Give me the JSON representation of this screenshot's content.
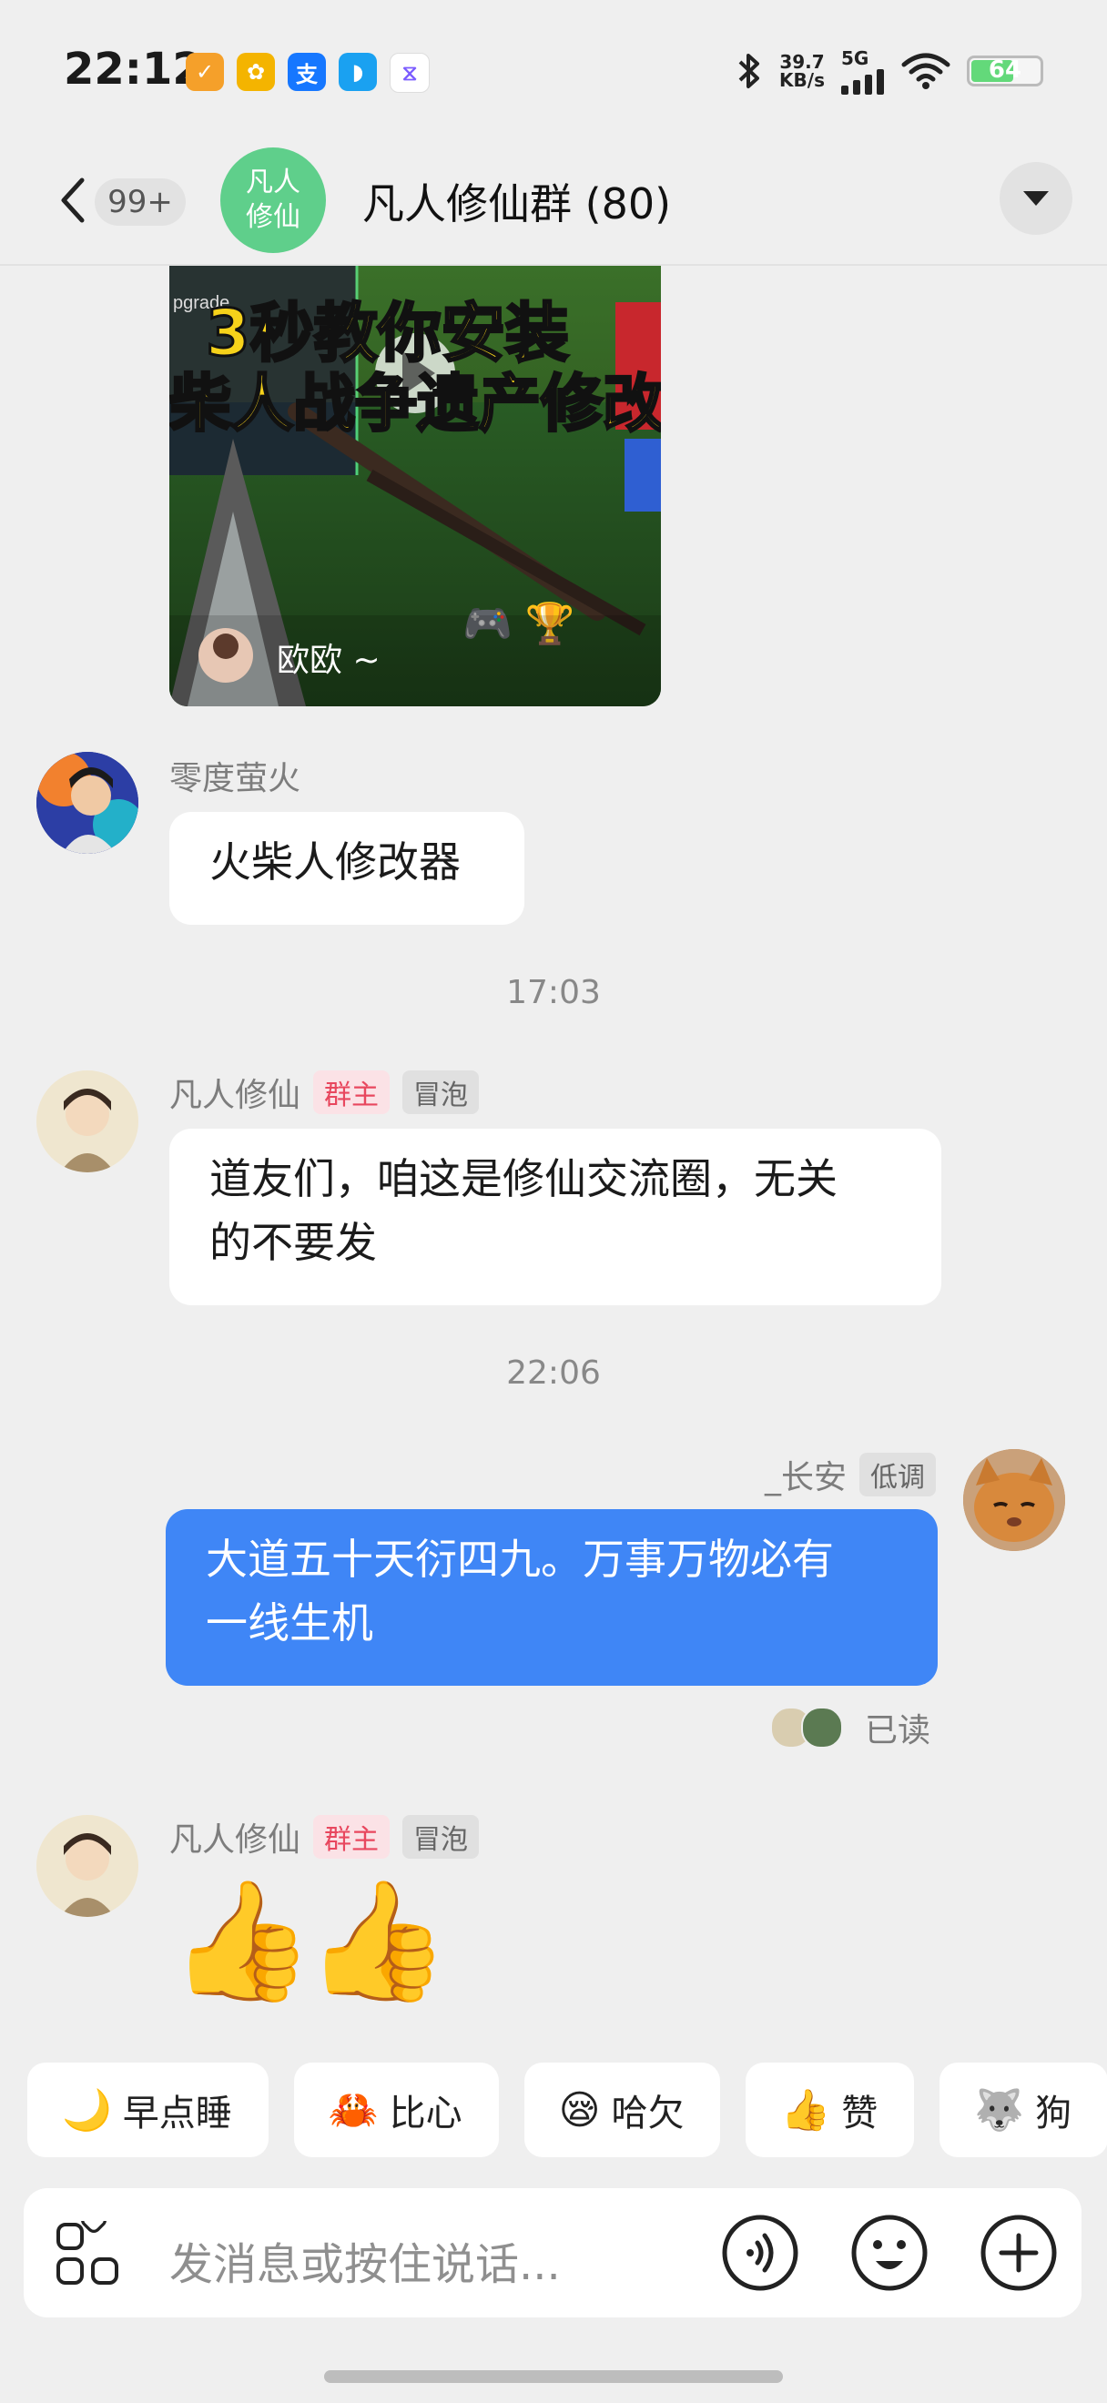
{
  "status_bar": {
    "time": "22:12",
    "net_speed_value": "39.7",
    "net_speed_unit": "KB/s",
    "signal_label": "5G",
    "battery_percent": "64",
    "battery_level": 0.64,
    "app_icons": [
      {
        "name": "app-icon-1",
        "color": "#f5a02a",
        "glyph": "✓"
      },
      {
        "name": "app-icon-2",
        "color": "#f4b400",
        "glyph": "✿"
      },
      {
        "name": "alipay-icon",
        "color": "#1677ff",
        "glyph": "支"
      },
      {
        "name": "app-icon-4",
        "color": "#1aa1f1",
        "glyph": "◗"
      },
      {
        "name": "hourglass-icon",
        "color": "#ffffff",
        "glyph": "⧖"
      }
    ]
  },
  "header": {
    "unread_count": "99+",
    "group_avatar_line1": "凡人",
    "group_avatar_line2": "修仙",
    "group_title": "凡人修仙群 (80)"
  },
  "video_card": {
    "title_line1": "3秒教你安装",
    "title_line2": "柴人战争遗产修改",
    "corner_text": "pgrade",
    "author": "欧欧 ~"
  },
  "messages": {
    "m1": {
      "sender": "零度萤火",
      "text": "火柴人修改器"
    },
    "time1": "17:03",
    "m2": {
      "sender": "凡人修仙",
      "badge_role": "群主",
      "badge_level": "冒泡",
      "line1": "道友们，咱这是修仙交流圈，无关",
      "line2": "的不要发"
    },
    "time2": "22:06",
    "m3": {
      "sender": "_长安",
      "badge_level": "低调",
      "line1": "大道五十天衍四九。万事万物必有",
      "line2": "一线生机",
      "read_status": "已读"
    },
    "m4": {
      "sender": "凡人修仙",
      "badge_role": "群主",
      "badge_level": "冒泡",
      "emoji": "👍👍"
    }
  },
  "quick_replies": [
    {
      "emoji": "🌙",
      "label": "早点睡"
    },
    {
      "emoji": "🦀",
      "label": "比心"
    },
    {
      "emoji": "😪",
      "label": "哈欠"
    },
    {
      "emoji": "👍",
      "label": "赞"
    },
    {
      "emoji": "🐺",
      "label": "狗"
    }
  ],
  "input": {
    "placeholder": "发消息或按住说话..."
  },
  "colors": {
    "background": "#efefef",
    "bubble_self": "#3f86f6",
    "group_avatar": "#5fcf8b",
    "owner_badge_text": "#e8475e"
  }
}
